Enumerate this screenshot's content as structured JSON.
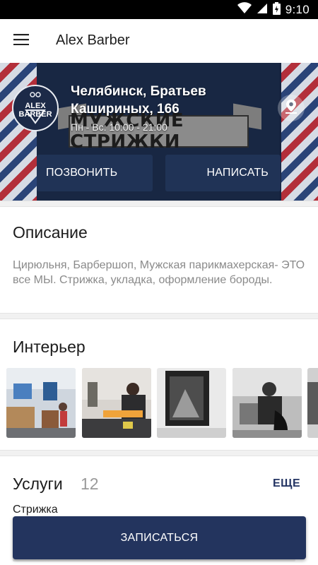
{
  "status_bar": {
    "time": "9:10"
  },
  "app_bar": {
    "title": "Alex Barber"
  },
  "hero": {
    "logo_text": "ALEX BARBER",
    "sign_text": "МУЖСКИЕ СТРИЖКИ",
    "address": "Челябинск, Братьев Кашириных, 166",
    "hours": "Пн - Вс: 10:00 - 21:00",
    "call_label": "ПОЗВОНИТЬ",
    "write_label": "НАПИСАТЬ"
  },
  "description": {
    "title": "Описание",
    "text": "Цирюльня, Барбершоп, Мужская парикмахерская- ЭТО все МЫ. Стрижка, укладка, оформление бороды."
  },
  "interior": {
    "title": "Интерьер",
    "photos": [
      "interior-photo-1",
      "interior-photo-2",
      "interior-photo-3",
      "interior-photo-4",
      "interior-photo-5"
    ]
  },
  "services": {
    "title": "Услуги",
    "count": "12",
    "more_label": "ЕЩЕ",
    "items": [
      "Стрижка"
    ]
  },
  "book_button": {
    "label": "ЗАПИСАТЬСЯ"
  },
  "colors": {
    "primary": "#23345e",
    "hero_bg": "#16233f",
    "muted_text": "#8a8a8a"
  }
}
